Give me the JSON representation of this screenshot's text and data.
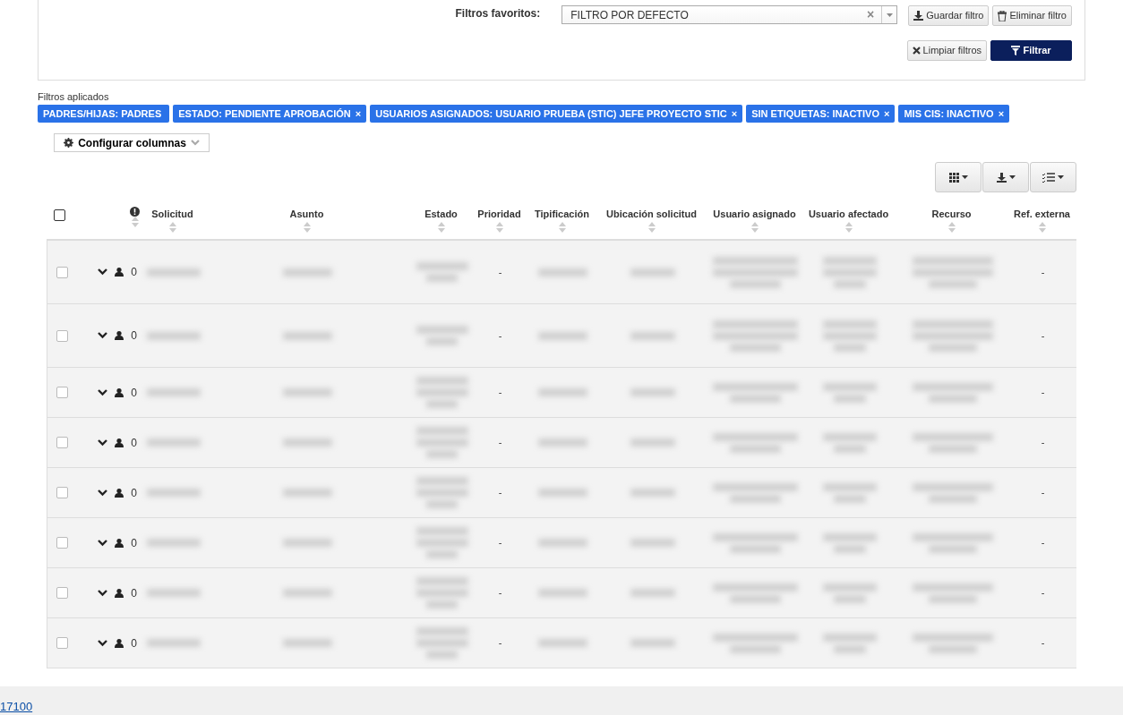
{
  "filters_panel": {
    "favorites_label": "Filtros favoritos:",
    "favorite_select": {
      "value": "FILTRO POR DEFECTO",
      "clear": "×"
    },
    "buttons": [
      {
        "kind": "download",
        "label": "Guardar filtro",
        "primary": false
      },
      {
        "kind": "trash",
        "label": "Eliminar filtro",
        "primary": false
      },
      {
        "kind": "clear",
        "label": "Limpiar filtros",
        "primary": false
      },
      {
        "kind": "filter",
        "label": "Filtrar",
        "primary": true
      }
    ]
  },
  "applied_filters": {
    "label": "Filtros aplicados",
    "tags": [
      {
        "label": "PADRES/HIJAS: PADRES"
      },
      {
        "label": "ESTADO: PENDIENTE APROBACIÓN",
        "close": "×"
      },
      {
        "label": "USUARIOS ASIGNADOS: USUARIO PRUEBA (STIC) JEFE PROYECTO STIC",
        "close": "×"
      },
      {
        "label": "SIN ETIQUETAS: INACTIVO",
        "close": "×"
      },
      {
        "label": "MIS CIS: INACTIVO",
        "close": "×"
      }
    ]
  },
  "configure_columns": {
    "label": "Configurar columnas"
  },
  "toolbar": [
    {
      "kind": "grid"
    },
    {
      "kind": "download"
    },
    {
      "kind": "checklist"
    }
  ],
  "table": {
    "select_all": {
      "checked": false
    },
    "columns": [
      "Solicitud",
      "Asunto",
      "Estado",
      "Prioridad",
      "Tipificación",
      "Ubicación solicitud",
      "Usuario asignado",
      "Usuario afectado",
      "Recurso",
      "Ref. externa"
    ],
    "rows": [
      {
        "checked": false,
        "tall": true,
        "count": "0",
        "priority": "-",
        "ref": "-"
      },
      {
        "checked": false,
        "tall": true,
        "count": "0",
        "priority": "-",
        "ref": "-"
      },
      {
        "checked": false,
        "tall": false,
        "count": "0",
        "priority": "-",
        "ref": "-"
      },
      {
        "checked": false,
        "tall": false,
        "count": "0",
        "priority": "-",
        "ref": "-"
      },
      {
        "checked": false,
        "tall": false,
        "count": "0",
        "priority": "-",
        "ref": "-"
      },
      {
        "checked": false,
        "tall": false,
        "count": "0",
        "priority": "-",
        "ref": "-"
      },
      {
        "checked": false,
        "tall": false,
        "count": "0",
        "priority": "-",
        "ref": "-"
      },
      {
        "checked": false,
        "tall": false,
        "count": "0",
        "priority": "-",
        "ref": "-"
      }
    ]
  },
  "footer": {
    "link": "17100"
  }
}
